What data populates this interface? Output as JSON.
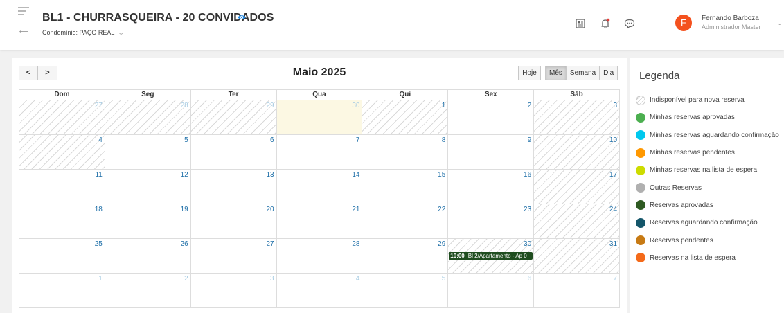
{
  "header": {
    "title": "BL1 - CHURRASQUEIRA - 20 CONVIDADOS",
    "condominium": "Condomínio: PAÇO REAL",
    "user_name": "Fernando Barboza",
    "user_role": "Administrador Master",
    "avatar_initial": "F",
    "icons": [
      "menu-icon",
      "back-arrow-icon",
      "eye-icon",
      "news-icon",
      "bell-icon",
      "chat-icon",
      "chevron-down-icon"
    ]
  },
  "calendar": {
    "prev_label": "<",
    "next_label": ">",
    "month_title": "Maio 2025",
    "today_label": "Hoje",
    "views": [
      {
        "label": "Mês",
        "active": true
      },
      {
        "label": "Semana",
        "active": false
      },
      {
        "label": "Dia",
        "active": false
      }
    ],
    "weekdays": [
      "Dom",
      "Seg",
      "Ter",
      "Qua",
      "Qui",
      "Sex",
      "Sáb"
    ],
    "weeks": [
      [
        {
          "day": "27",
          "other": true,
          "hatched": true
        },
        {
          "day": "28",
          "other": true,
          "hatched": true
        },
        {
          "day": "29",
          "other": true,
          "hatched": true
        },
        {
          "day": "30",
          "other": true,
          "today": true
        },
        {
          "day": "1",
          "hatched": true
        },
        {
          "day": "2"
        },
        {
          "day": "3",
          "hatched": true
        }
      ],
      [
        {
          "day": "4",
          "hatched": true
        },
        {
          "day": "5"
        },
        {
          "day": "6"
        },
        {
          "day": "7"
        },
        {
          "day": "8"
        },
        {
          "day": "9"
        },
        {
          "day": "10",
          "hatched": true
        }
      ],
      [
        {
          "day": "11"
        },
        {
          "day": "12"
        },
        {
          "day": "13"
        },
        {
          "day": "14"
        },
        {
          "day": "15"
        },
        {
          "day": "16"
        },
        {
          "day": "17",
          "hatched": true
        }
      ],
      [
        {
          "day": "18"
        },
        {
          "day": "19"
        },
        {
          "day": "20"
        },
        {
          "day": "21"
        },
        {
          "day": "22"
        },
        {
          "day": "23"
        },
        {
          "day": "24",
          "hatched": true
        }
      ],
      [
        {
          "day": "25"
        },
        {
          "day": "26"
        },
        {
          "day": "27"
        },
        {
          "day": "28"
        },
        {
          "day": "29"
        },
        {
          "day": "30",
          "hatched": true,
          "event": {
            "time": "10:00",
            "title": "Bl 2/Apartamento - Ap 0"
          }
        },
        {
          "day": "31",
          "hatched": true
        }
      ],
      [
        {
          "day": "1",
          "other": true
        },
        {
          "day": "2",
          "other": true
        },
        {
          "day": "3",
          "other": true
        },
        {
          "day": "4",
          "other": true
        },
        {
          "day": "5",
          "other": true
        },
        {
          "day": "6",
          "other": true
        },
        {
          "day": "7",
          "other": true
        }
      ]
    ]
  },
  "legend": {
    "title": "Legenda",
    "items": [
      {
        "label": "Indisponível para nova reserva",
        "color": "hatched"
      },
      {
        "label": "Minhas reservas aprovadas",
        "color": "#4caf50"
      },
      {
        "label": "Minhas reservas aguardando confirmação",
        "color": "#00c8ee"
      },
      {
        "label": "Minhas reservas pendentes",
        "color": "#ff9800"
      },
      {
        "label": "Minhas reservas na lista de espera",
        "color": "#cddc00"
      },
      {
        "label": "Outras Reservas",
        "color": "#b0b0b0"
      },
      {
        "label": "Reservas aprovadas",
        "color": "#2e5a22"
      },
      {
        "label": "Reservas aguardando confirmação",
        "color": "#14566a"
      },
      {
        "label": "Reservas pendentes",
        "color": "#c77a14"
      },
      {
        "label": "Reservas na lista de espera",
        "color": "#f46a1a"
      }
    ]
  }
}
